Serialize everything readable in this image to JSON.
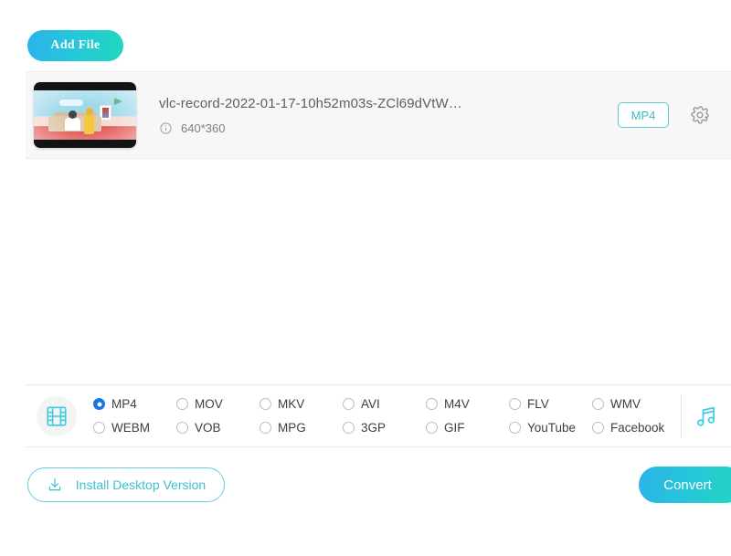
{
  "colors": {
    "accent_gradient_start": "#2cb3ea",
    "accent_gradient_end": "#22d6bf",
    "teal": "#3fbfcd",
    "radio_selected_blue": "#1a73e8",
    "row_background": "#f7f7f7",
    "page_background": "#ffffff"
  },
  "toolbar": {
    "add_file_label": "Add File"
  },
  "file_list": {
    "files": [
      {
        "name": "vlc-record-2022-01-17-10h52m03s-ZCl69dVtW…",
        "resolution": "640*360",
        "info_icon": "info-circle-icon",
        "output_format": "MP4",
        "settings_icon": "gear-icon",
        "thumbnail_icon": "video-thumbnail"
      }
    ]
  },
  "format_bar": {
    "video_icon": "film-strip-icon",
    "audio_icon": "music-note-icon",
    "selected": "MP4",
    "options": [
      "MP4",
      "MOV",
      "MKV",
      "AVI",
      "M4V",
      "FLV",
      "WMV",
      "WEBM",
      "VOB",
      "MPG",
      "3GP",
      "GIF",
      "YouTube",
      "Facebook"
    ]
  },
  "footer": {
    "install_label": "Install Desktop Version",
    "install_icon": "download-icon",
    "convert_label": "Convert"
  }
}
